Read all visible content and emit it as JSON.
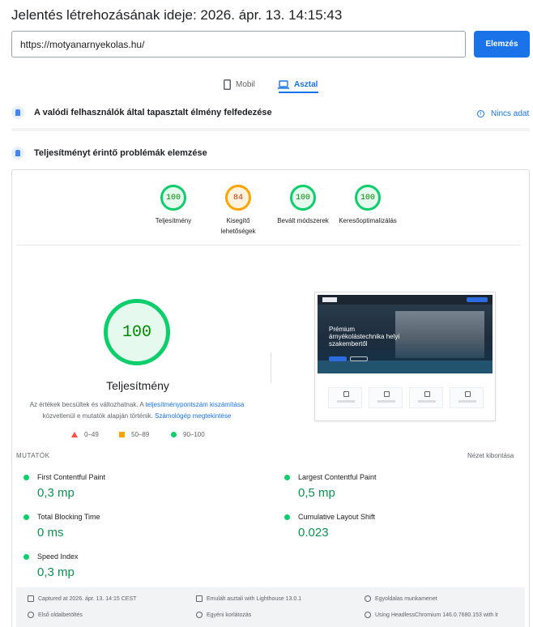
{
  "header": {
    "title": "Jelentés létrehozásának ideje: 2026. ápr. 13. 14:15:43"
  },
  "url_bar": {
    "value": "https://motyanarnyekolas.hu/",
    "analyze_label": "Elemzés"
  },
  "tabs": [
    {
      "label": "Mobil",
      "icon": "phone-icon",
      "active": false
    },
    {
      "label": "Asztal",
      "icon": "laptop-icon",
      "active": true
    }
  ],
  "field_section": {
    "title": "A valódi felhasználók által tapasztalt élmény felfedezése",
    "no_data": "Nincs adat"
  },
  "lab_section": {
    "title": "Teljesítményt érintő problémák elemzése"
  },
  "gauges": [
    {
      "score": "100",
      "label": "Teljesítmény",
      "color": "#0cce6b"
    },
    {
      "score": "84",
      "label": "Kisegítő lehetőségek",
      "color": "#ffa400"
    },
    {
      "score": "100",
      "label": "Bevált módszerek",
      "color": "#0cce6b"
    },
    {
      "score": "100",
      "label": "Keresőoptimalizálás",
      "color": "#0cce6b"
    }
  ],
  "main_score": {
    "score": "100",
    "label": "Teljesítmény",
    "note_part1": "Az értékek becsültek és változhatnak. A ",
    "note_link1": "teljesítménypontszám kiszámítása",
    "note_part2": "közvetlenül e mutatók alapján történik.",
    "note_link2": "Számológép megtekintése"
  },
  "legend": [
    {
      "range": "0–49",
      "shape": "triangle",
      "color": "#ff4e42"
    },
    {
      "range": "50–89",
      "shape": "square",
      "color": "#ffa400"
    },
    {
      "range": "90–100",
      "shape": "circle",
      "color": "#0cce6b"
    }
  ],
  "screenshot": {
    "heading": "Prémium árnyékolástechnika helyi szakembertől"
  },
  "metrics": {
    "heading": "MUTATÓK",
    "expand": "Nézet kibontása",
    "items": [
      {
        "name": "First Contentful Paint",
        "value": "0,3 mp"
      },
      {
        "name": "Largest Contentful Paint",
        "value": "0,5 mp"
      },
      {
        "name": "Total Blocking Time",
        "value": "0 ms"
      },
      {
        "name": "Cumulative Layout Shift",
        "value": "0.023"
      },
      {
        "name": "Speed Index",
        "value": "0,3 mp"
      }
    ]
  },
  "footer": {
    "captured": "Captured at 2026. ápr. 13. 14:15 CEST",
    "emulated": "Emulált asztali with Lighthouse 13.0.1",
    "session": "Egyoldalas munkamenet",
    "first_load": "Első oldalbetöltés",
    "throttling": "Egyéni korlátozás",
    "browser": "Using HeadlessChromium 146.0.7680.153 with lr"
  }
}
